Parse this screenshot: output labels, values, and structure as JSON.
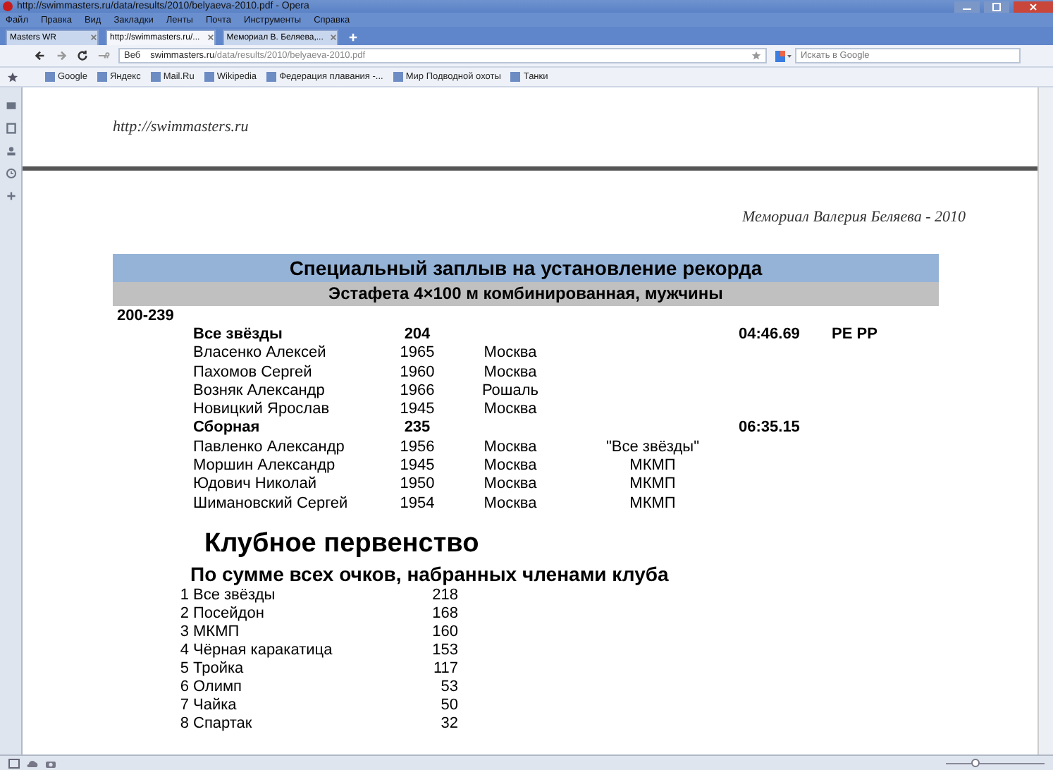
{
  "browser": {
    "window_title": "http://swimmasters.ru/data/results/2010/belyaeva-2010.pdf - Opera",
    "menu": [
      "Файл",
      "Правка",
      "Вид",
      "Закладки",
      "Ленты",
      "Почта",
      "Инструменты",
      "Справка"
    ],
    "tabs": [
      {
        "label": "Masters WR",
        "selected": false
      },
      {
        "label": "http://swimmasters.ru/...",
        "selected": true
      },
      {
        "label": "Мемориал В. Беляева,...",
        "selected": false
      }
    ],
    "address_bar": {
      "button": "Веб",
      "domain": "swimmasters.ru",
      "path": "/data/results/2010/belyaeva-2010.pdf"
    },
    "search": {
      "placeholder": "Искать в Google"
    },
    "zoom": {
      "level": 0.3
    },
    "bookmarks": [
      "Google",
      "Яндекс",
      "Mail.Ru",
      "Wikipedia",
      "Федерация плавания -...",
      "Мир Подводной охоты",
      "Танки"
    ]
  },
  "document": {
    "header_link": "http://swimmasters.ru",
    "event_title": "Мемориал Валерия Беляева - 2010",
    "banner_title": "Специальный заплыв на установление рекорда",
    "banner_subtitle": "Эстафета 4×100 м комбинированная, мужчины",
    "age_group": "200-239",
    "relay_rows": [
      {
        "kind": "team",
        "name": "Все звёзды",
        "number": "204",
        "time": "04:46.69",
        "note": "РЕ РР"
      },
      {
        "kind": "member",
        "name": "Власенко Алексей",
        "number": "1965",
        "city": "Москва"
      },
      {
        "kind": "member",
        "name": "Пахомов Сергей",
        "number": "1960",
        "city": "Москва"
      },
      {
        "kind": "member",
        "name": "Возняк Александр",
        "number": "1966",
        "city": "Рошаль"
      },
      {
        "kind": "member",
        "name": "Новицкий Ярослав",
        "number": "1945",
        "city": "Москва"
      },
      {
        "kind": "team",
        "name": "Сборная",
        "number": "235",
        "time": "06:35.15"
      },
      {
        "kind": "member",
        "name": "Павленко Александр",
        "number": "1956",
        "city": "Москва",
        "club": "\"Все звёзды\""
      },
      {
        "kind": "member",
        "name": "Моршин Александр",
        "number": "1945",
        "city": "Москва",
        "club": "МКМП"
      },
      {
        "kind": "member",
        "name": "Юдович Николай",
        "number": "1950",
        "city": "Москва",
        "club": "МКМП"
      },
      {
        "kind": "member",
        "name": "Шимановский Сергей",
        "number": "1954",
        "city": "Москва",
        "club": "МКМП"
      }
    ],
    "club_title": "Клубное первенство",
    "club_subtitle": "По сумме всех очков, набранных членами клуба",
    "standings": [
      {
        "place": "1",
        "club": "Все звёзды",
        "points": "218"
      },
      {
        "place": "2",
        "club": "Посейдон",
        "points": "168"
      },
      {
        "place": "3",
        "club": "МКМП",
        "points": "160"
      },
      {
        "place": "4",
        "club": "Чёрная каракатица",
        "points": "153"
      },
      {
        "place": "5",
        "club": "Тройка",
        "points": "117"
      },
      {
        "place": "6",
        "club": "Олимп",
        "points": "53"
      },
      {
        "place": "7",
        "club": "Чайка",
        "points": "50"
      },
      {
        "place": "8",
        "club": "Спартак",
        "points": "32"
      }
    ]
  }
}
